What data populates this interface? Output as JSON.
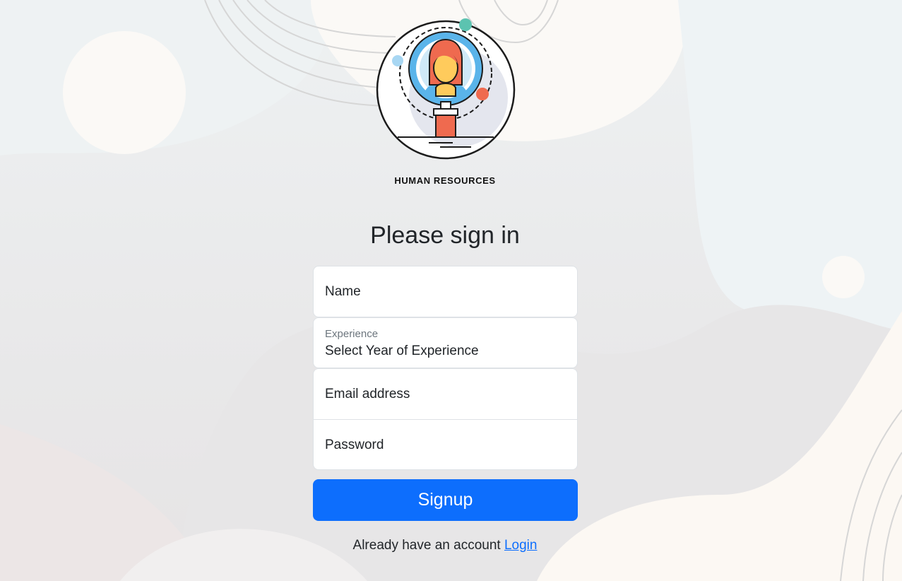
{
  "brand": {
    "name": "HUMAN RESOURCES"
  },
  "form": {
    "title": "Please sign in",
    "name_label": "Name",
    "experience_label": "Experience",
    "experience_value": "Select Year of Experience",
    "email_label": "Email address",
    "password_label": "Password",
    "submit_label": "Signup"
  },
  "footer": {
    "text": "Already have an account",
    "link_label": "Login"
  },
  "colors": {
    "primary": "#0d6efd",
    "logo_hair": "#ef6a4f",
    "logo_skin": "#ffcb5c",
    "logo_ring": "#5ab4ea",
    "logo_teal": "#5cc3b0"
  },
  "icons": {
    "logo": "hr-person-magnifier-icon"
  }
}
